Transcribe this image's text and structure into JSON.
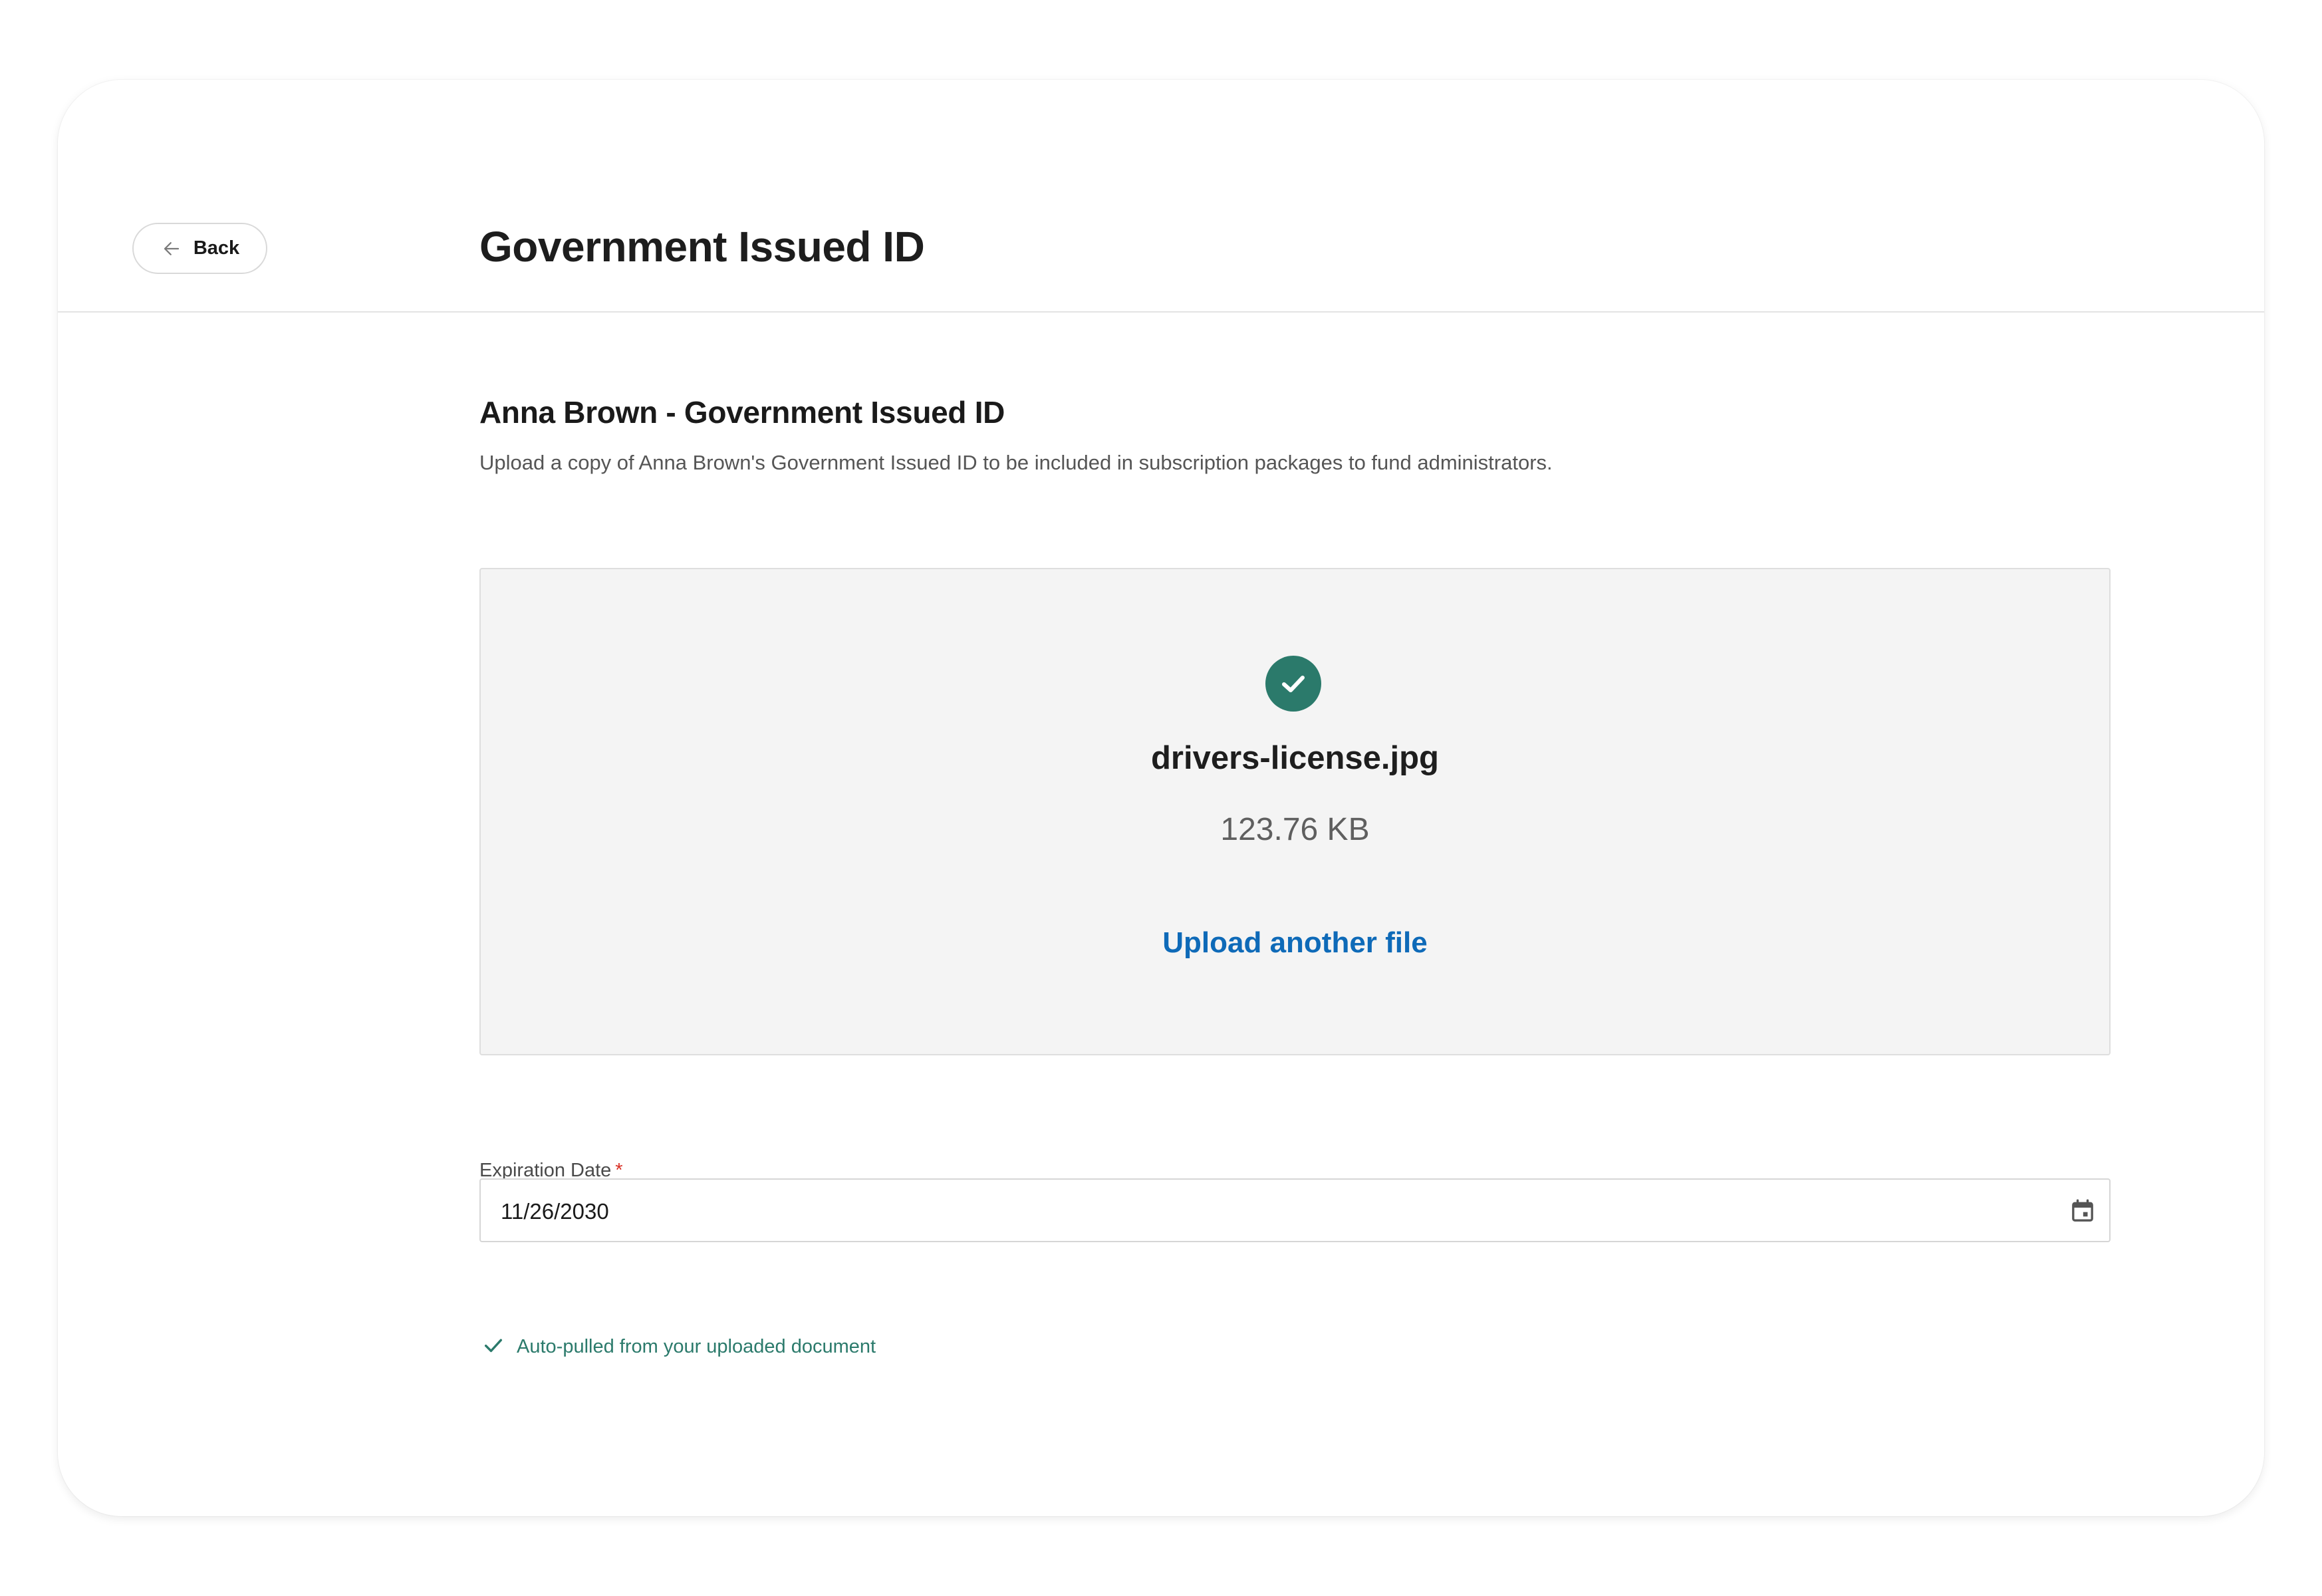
{
  "header": {
    "back_label": "Back",
    "title": "Government Issued ID"
  },
  "section": {
    "title": "Anna Brown - Government Issued ID",
    "description": "Upload a copy of Anna Brown's Government Issued ID to be included in subscription packages to fund administrators."
  },
  "upload": {
    "status_icon": "check-circle-icon",
    "file_name": "drivers-license.jpg",
    "file_size": "123.76 KB",
    "action_label": "Upload another file"
  },
  "expiration": {
    "label": "Expiration Date",
    "required_marker": "*",
    "value": "11/26/2030",
    "calendar_icon": "calendar-icon",
    "hint": "Auto-pulled from your uploaded document"
  },
  "colors": {
    "accent_green": "#2b7a6b",
    "link_blue": "#0e6ab8",
    "required_red": "#d93025",
    "upload_bg": "#f4f4f4"
  }
}
